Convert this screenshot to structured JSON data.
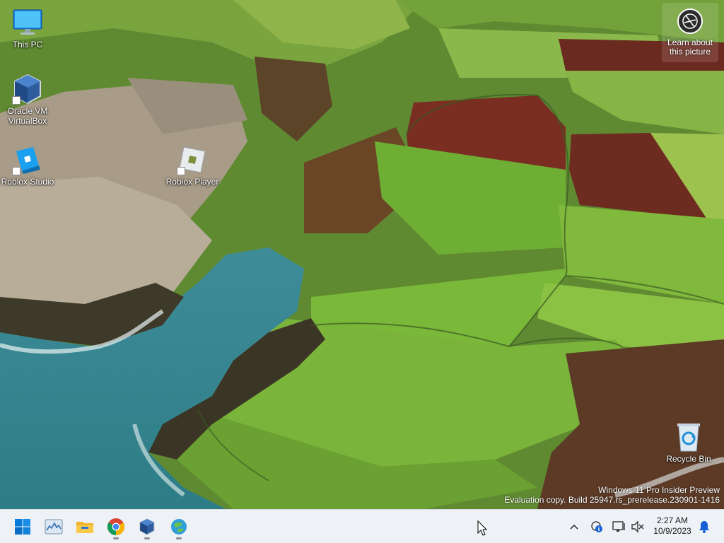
{
  "desktop": {
    "icons": [
      {
        "label": "This PC"
      },
      {
        "label": "Oracle VM VirtualBox"
      },
      {
        "label": "Roblox Studio"
      },
      {
        "label": "Roblox Player"
      },
      {
        "label": "Recycle Bin"
      }
    ],
    "learn_about": "Learn about this picture",
    "watermark": {
      "line1": "Windows 11 Pro Insider Preview",
      "line2": "Evaluation copy. Build 25947.rs_prerelease.230901-1416"
    }
  },
  "taskbar": {
    "apps": [
      {
        "icon": "start-icon"
      },
      {
        "icon": "task-manager-icon"
      },
      {
        "icon": "file-explorer-icon"
      },
      {
        "icon": "chrome-icon"
      },
      {
        "icon": "virtualbox-icon"
      },
      {
        "icon": "roblox-studio-icon"
      }
    ],
    "tray": {
      "time": "2:27 AM",
      "date": "10/9/2023"
    }
  },
  "colors": {
    "taskbar_bg": "#eef1f5",
    "notification_bell": "#1560d4",
    "start_blue": "#0a7ad9"
  }
}
